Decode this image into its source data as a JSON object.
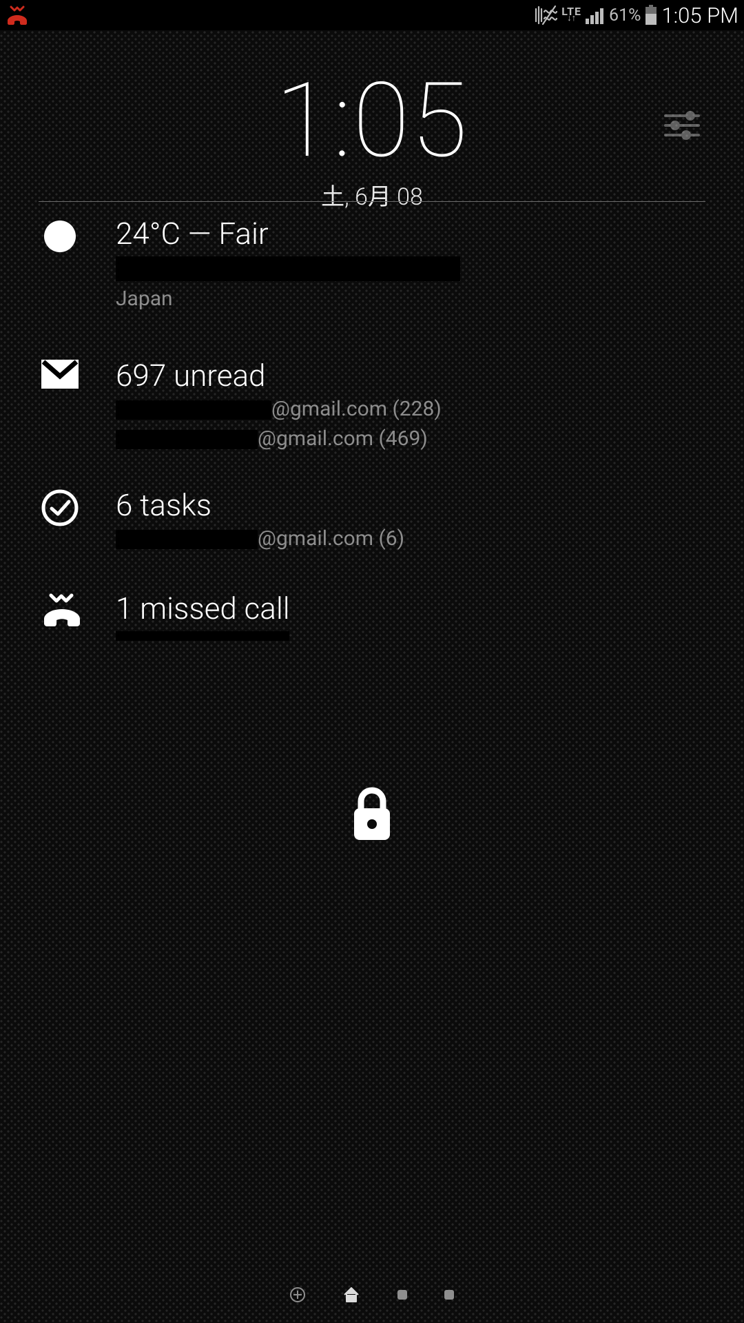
{
  "statusbar": {
    "network_label": "LTE",
    "battery_percent": "61%",
    "time": "1:05 PM"
  },
  "clock": {
    "time": "1:05",
    "date": "土, 6月 08"
  },
  "weather": {
    "headline": "24°C — Fair",
    "location": "Japan"
  },
  "mail": {
    "headline": "697 unread",
    "account1_suffix": "@gmail.com (228)",
    "account2_suffix": "@gmail.com (469)"
  },
  "tasks": {
    "headline": "6 tasks",
    "account_suffix": "@gmail.com (6)"
  },
  "calls": {
    "headline": "1 missed call"
  }
}
